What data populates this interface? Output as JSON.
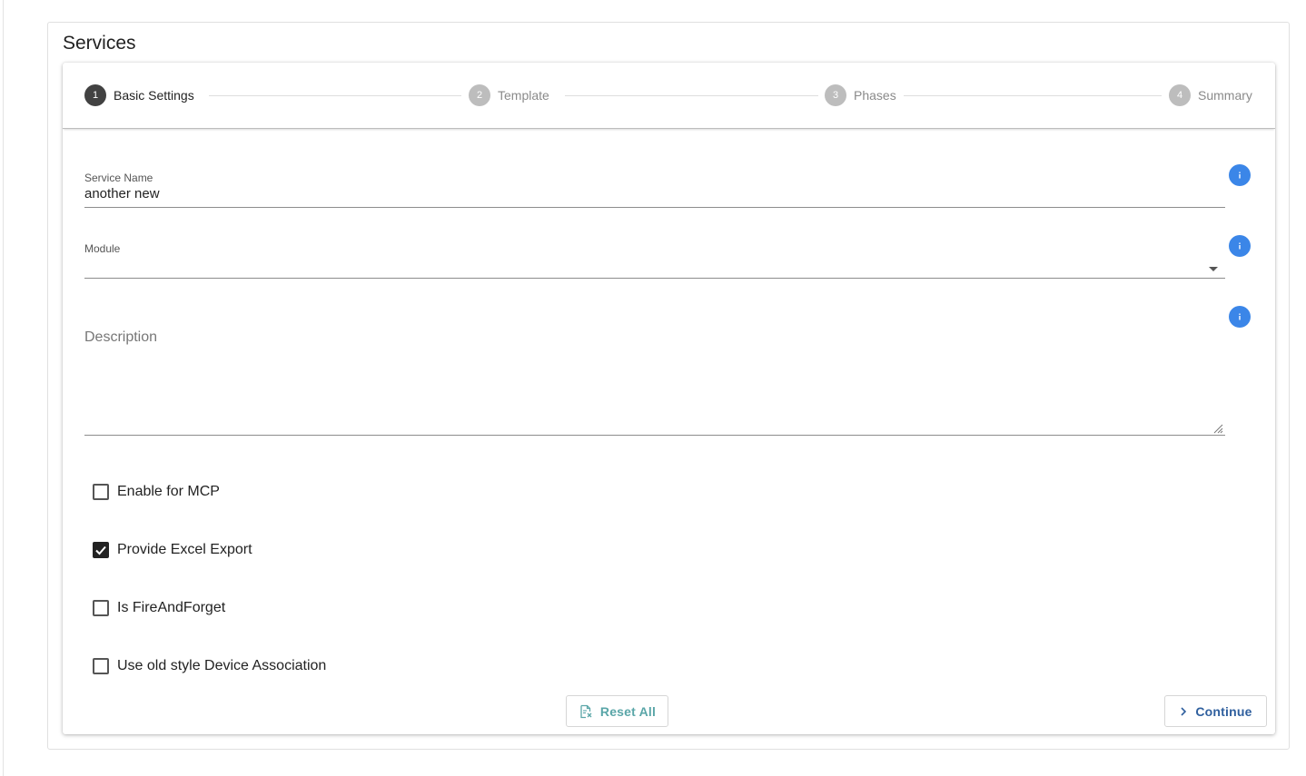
{
  "page": {
    "title": "Services"
  },
  "stepper": {
    "steps": [
      {
        "number": "1",
        "label": "Basic Settings",
        "state": "active"
      },
      {
        "number": "2",
        "label": "Template",
        "state": "inactive"
      },
      {
        "number": "3",
        "label": "Phases",
        "state": "inactive"
      },
      {
        "number": "4",
        "label": "Summary",
        "state": "inactive"
      }
    ]
  },
  "form": {
    "service_name": {
      "label": "Service Name",
      "value": "another new"
    },
    "module": {
      "label": "Module",
      "value": ""
    },
    "description": {
      "label": "Description",
      "value": ""
    },
    "checkboxes": [
      {
        "label": "Enable for MCP",
        "checked": false
      },
      {
        "label": "Provide Excel Export",
        "checked": true
      },
      {
        "label": "Is FireAndForget",
        "checked": false
      },
      {
        "label": "Use old style Device Association",
        "checked": false
      }
    ]
  },
  "actions": {
    "reset_label": "Reset All",
    "continue_label": "Continue"
  },
  "icons": {
    "info": "info-icon",
    "reset": "file-clear-icon",
    "continue": "chevron-right-icon",
    "dropdown": "dropdown-arrow-icon"
  },
  "colors": {
    "info_blue": "#3b86e8",
    "step_active": "#424242",
    "step_inactive": "#bdbdbd",
    "reset_teal": "#5aa6a8",
    "continue_blue": "#2f5f9e"
  }
}
